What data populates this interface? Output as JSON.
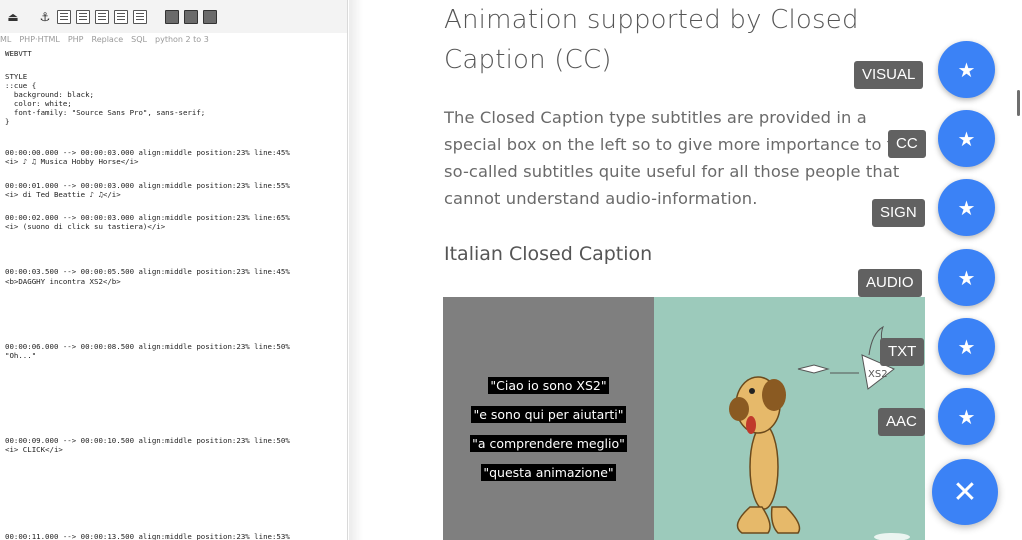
{
  "editor": {
    "tabs": [
      "ML",
      "PHP·HTML",
      "PHP",
      "Replace",
      "SQL",
      "python 2 to 3"
    ],
    "lines": [
      "WEBVTT",
      "",
      "STYLE",
      "::cue {",
      "  background: black;",
      "  color: white;",
      "  font-family: \"Source Sans Pro\", sans-serif;",
      "}",
      "00:00:00.000 --> 00:00:03.000 align:middle position:23% line:45%",
      "<i> ♪ ♫ Musica Hobby Horse</i>",
      "00:00:01.000 --> 00:00:03.000 align:middle position:23% line:55%",
      "<i> di Ted Beattie ♪ ♫</i>",
      "00:00:02.000 --> 00:00:03.000 align:middle position:23% line:65%",
      "<i> (suono di click su tastiera)</i>",
      "00:00:03.500 --> 00:00:05.500 align:middle position:23% line:45%",
      "<b>DAGGHY incontra XS2</b>",
      "00:00:06.000 --> 00:00:08.500 align:middle position:23% line:50%",
      "\"Oh...\"",
      "00:00:09.000 --> 00:00:10.500 align:middle position:23% line:50%",
      "<i> CLICK</i>",
      "00:00:11.000 --> 00:00:13.500 align:middle position:23% line:53%"
    ]
  },
  "content": {
    "title": "Animation supported by Closed Caption (CC)",
    "intro": "The Closed Caption type subtitles are provided in a special box on the left so to give more importance to the so-called subtitles quite useful for all those people that cannot understand audio-information.",
    "section_title": "Italian Closed Caption",
    "captions": [
      "\"Ciao io sono XS2\"",
      "\"e sono qui per aiutarti\"",
      "\"a comprendere meglio\"",
      "\"questa animazione\""
    ],
    "xs2_label": "XS2"
  },
  "fab_menu": {
    "items": [
      {
        "label": "VISUAL",
        "icon": "star-icon"
      },
      {
        "label": "CC",
        "icon": "star-icon"
      },
      {
        "label": "SIGN",
        "icon": "star-icon"
      },
      {
        "label": "AUDIO",
        "icon": "star-icon"
      },
      {
        "label": "TXT",
        "icon": "star-icon"
      },
      {
        "label": "AAC",
        "icon": "star-icon"
      }
    ],
    "close_icon": "close-icon",
    "accent": "#3b82f6"
  }
}
